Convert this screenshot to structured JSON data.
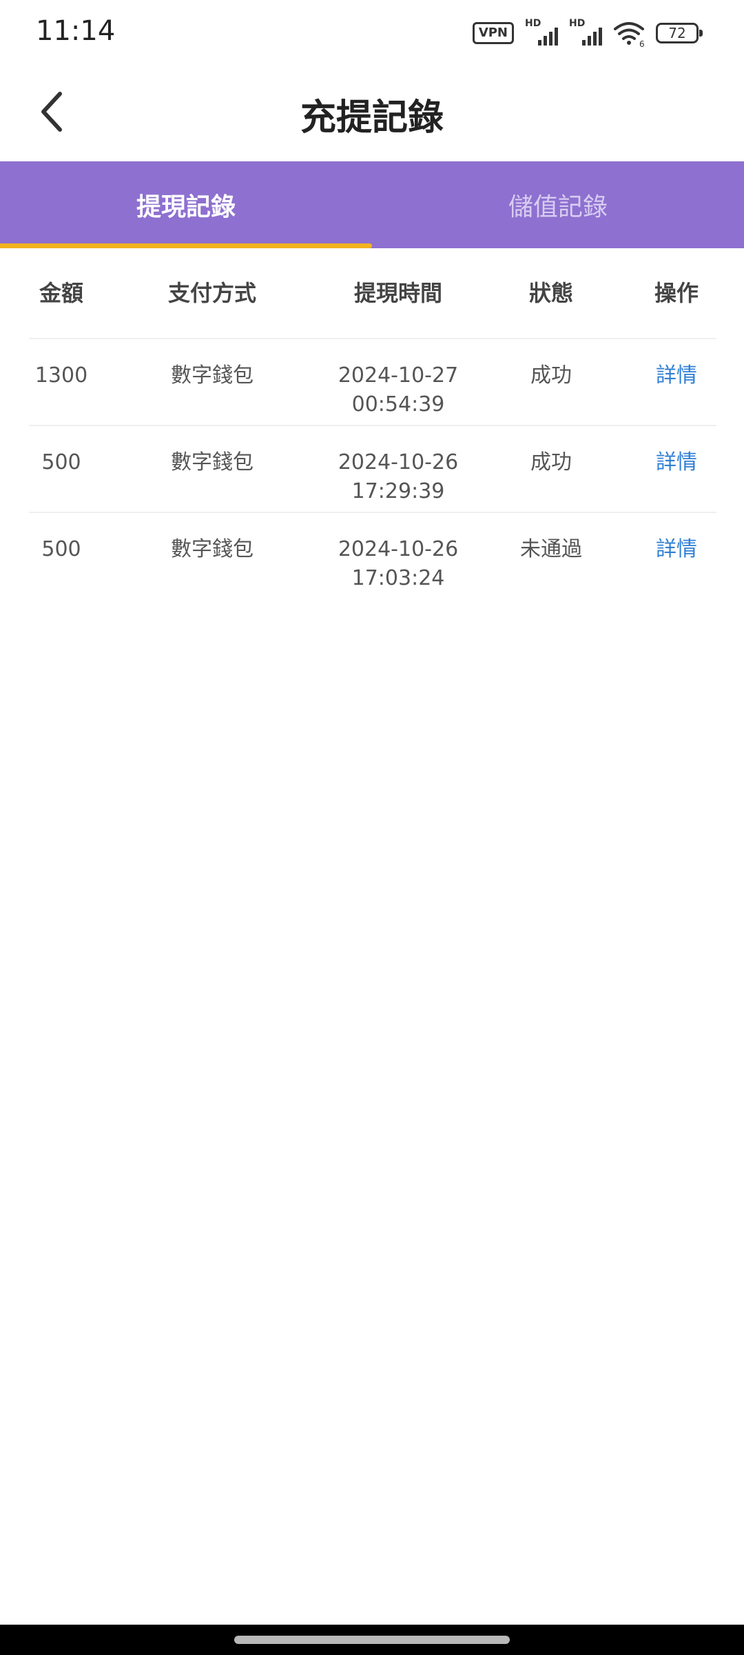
{
  "status_bar": {
    "time": "11:14",
    "vpn_label": "VPN",
    "sim1_label": "HD",
    "sim2_label": "HD",
    "battery_level": "72",
    "wifi_suffix": "6"
  },
  "header": {
    "title": "充提記錄",
    "back_icon": "chevron-left-icon"
  },
  "tabs": [
    {
      "label": "提現記錄",
      "active": true
    },
    {
      "label": "儲值記錄",
      "active": false
    }
  ],
  "colors": {
    "tab_background": "#8e70d0",
    "tab_indicator": "#f2b31f",
    "link": "#2f7fd4"
  },
  "table": {
    "columns": [
      "金額",
      "支付方式",
      "提現時間",
      "狀態",
      "操作"
    ],
    "rows": [
      {
        "amount": "1300",
        "method": "數字錢包",
        "date": "2024-10-27",
        "time": "00:54:39",
        "status": "成功",
        "action": "詳情"
      },
      {
        "amount": "500",
        "method": "數字錢包",
        "date": "2024-10-26",
        "time": "17:29:39",
        "status": "成功",
        "action": "詳情"
      },
      {
        "amount": "500",
        "method": "數字錢包",
        "date": "2024-10-26",
        "time": "17:03:24",
        "status": "未通過",
        "action": "詳情"
      }
    ]
  }
}
